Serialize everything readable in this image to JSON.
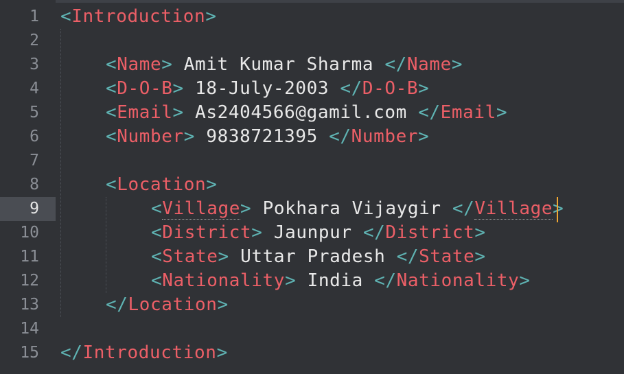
{
  "editor": {
    "lines": [
      {
        "number": "1",
        "open": "<",
        "tag": "Introduction",
        "close": ">"
      },
      {
        "number": "2"
      },
      {
        "number": "3",
        "open": "<",
        "tag": "Name",
        "close": ">",
        "value": " Amit Kumar Sharma ",
        "end_open": "</",
        "end_tag": "Name",
        "end_close": ">"
      },
      {
        "number": "4",
        "open": "<",
        "tag": "D-O-B",
        "close": ">",
        "value": " 18-July-2003 ",
        "end_open": "</",
        "end_tag": "D-O-B",
        "end_close": ">"
      },
      {
        "number": "5",
        "open": "<",
        "tag": "Email",
        "close": ">",
        "value": " As2404566@gamil.com ",
        "end_open": "</",
        "end_tag": "Email",
        "end_close": ">"
      },
      {
        "number": "6",
        "open": "<",
        "tag": "Number",
        "close": ">",
        "value": " 9838721395 ",
        "end_open": "</",
        "end_tag": "Number",
        "end_close": ">"
      },
      {
        "number": "7"
      },
      {
        "number": "8",
        "open": "<",
        "tag": "Location",
        "close": ">"
      },
      {
        "number": "9",
        "open": "<",
        "tag": "Village",
        "close": ">",
        "value": " Pokhara Vijaygir ",
        "end_open": "</",
        "end_tag": "Village",
        "end_close": ">"
      },
      {
        "number": "10",
        "open": "<",
        "tag": "District",
        "close": ">",
        "value": " Jaunpur ",
        "end_open": "</",
        "end_tag": "District",
        "end_close": ">"
      },
      {
        "number": "11",
        "open": "<",
        "tag": "State",
        "close": ">",
        "value": " Uttar Pradesh ",
        "end_open": "</",
        "end_tag": "State",
        "end_close": ">"
      },
      {
        "number": "12",
        "open": "<",
        "tag": "Nationality",
        "close": ">",
        "value": " India ",
        "end_open": "</",
        "end_tag": "Nationality",
        "end_close": ">"
      },
      {
        "number": "13",
        "open": "</",
        "tag": "Location",
        "close": ">"
      },
      {
        "number": "14"
      },
      {
        "number": "15",
        "open": "</",
        "tag": "Introduction",
        "close": ">"
      }
    ],
    "active_line": "9",
    "colors": {
      "background": "#303236",
      "punctuation": "#5fb3b3",
      "tag": "#ec5f67",
      "text": "#e8e8e8",
      "caret": "#f0a732"
    }
  }
}
